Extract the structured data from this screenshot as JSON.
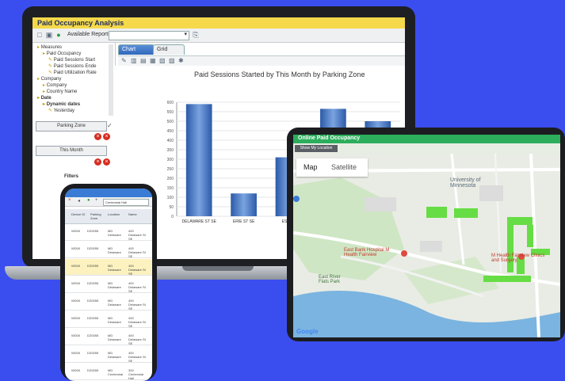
{
  "laptop": {
    "title": "Paid Occupancy Analysis",
    "toolbar": {
      "available_reports_label": "Available Reports"
    },
    "tree": [
      {
        "label": "Measures",
        "indent": 0,
        "bold": false
      },
      {
        "label": "Paid Occupancy",
        "indent": 1,
        "bold": false
      },
      {
        "label": "Paid Sessions Start",
        "indent": 2,
        "bold": false
      },
      {
        "label": "Paid Sessions Ende",
        "indent": 2,
        "bold": false
      },
      {
        "label": "Paid Utilization Rate",
        "indent": 2,
        "bold": false
      },
      {
        "label": "Company",
        "indent": 0,
        "bold": false
      },
      {
        "label": "Company",
        "indent": 1,
        "bold": false
      },
      {
        "label": "Country Name",
        "indent": 1,
        "bold": false
      },
      {
        "label": "Date",
        "indent": 0,
        "bold": true
      },
      {
        "label": "Dynamic dates",
        "indent": 1,
        "bold": true
      },
      {
        "label": "Yesterday",
        "indent": 2,
        "bold": false
      }
    ],
    "side": {
      "row_filter_1": "Parking Zone",
      "row_filter_2": "This Month",
      "filters_label": "Filters"
    },
    "tabs": {
      "chart": "Chart",
      "grid": "Grid"
    },
    "chart_title": "Paid Sessions Started by This Month by Parking Zone"
  },
  "chart_data": {
    "type": "bar",
    "title": "Paid Sessions Started by This Month by Parking Zone",
    "xlabel": "",
    "ylabel": "",
    "ylim": [
      0,
      600
    ],
    "yticks": [
      0,
      50,
      100,
      150,
      200,
      250,
      300,
      350,
      400,
      450,
      500,
      550,
      600
    ],
    "categories": [
      "DELAWARE ST SE",
      "ERIE ST SE",
      "ESSEX",
      "",
      ""
    ],
    "values": [
      590,
      120,
      310,
      565,
      500
    ],
    "bar_color": "#3f72c2",
    "grid": true,
    "legend": "none"
  },
  "tablet": {
    "header_title": "Online Paid Occupancy",
    "my_location_button": "Show My Location",
    "map_tab": "Map",
    "satellite_tab": "Satellite",
    "labels": {
      "university": "University of Minnesota",
      "hospital": "East Bank Hospital M Health Fairview",
      "clinics": "M Health Fairview Clinics and Surgery",
      "east_river": "East River Flats Park",
      "google": "Google"
    },
    "colors": {
      "header": "#2cae5d",
      "zone": "#66dd44",
      "river": "#7bb4e0"
    }
  },
  "phone": {
    "filter_text": "Centennial Hall",
    "headers": [
      "Device ID",
      "Parking Zone",
      "Location",
      "Name"
    ],
    "rows": [
      {
        "id": "WD00",
        "zone": "DZ0055",
        "loc": "MD Delaware",
        "name": "400 Delaware St SE"
      },
      {
        "id": "WD00",
        "zone": "DZ0055",
        "loc": "MD Delaware",
        "name": "400 Delaware St SE"
      },
      {
        "id": "WD00",
        "zone": "DZ0055",
        "loc": "MD Delaware",
        "name": "400 Delaware St SE"
      },
      {
        "id": "WD00",
        "zone": "DZ0055",
        "loc": "MD Delaware",
        "name": "400 Delaware St SE"
      },
      {
        "id": "WD00",
        "zone": "DZ0055",
        "loc": "MD Delaware",
        "name": "400 Delaware St SE"
      },
      {
        "id": "WD00",
        "zone": "DZ0055",
        "loc": "MD Delaware",
        "name": "400 Delaware St SE"
      },
      {
        "id": "WD00",
        "zone": "DZ0055",
        "loc": "MD Delaware",
        "name": "400 Delaware St SE"
      },
      {
        "id": "WD00",
        "zone": "DZ0055",
        "loc": "MD Delaware",
        "name": "400 Delaware St SE"
      },
      {
        "id": "WD00",
        "zone": "DZ0055",
        "loc": "MD Centennial",
        "name": "300 Centennial Hall"
      }
    ]
  }
}
